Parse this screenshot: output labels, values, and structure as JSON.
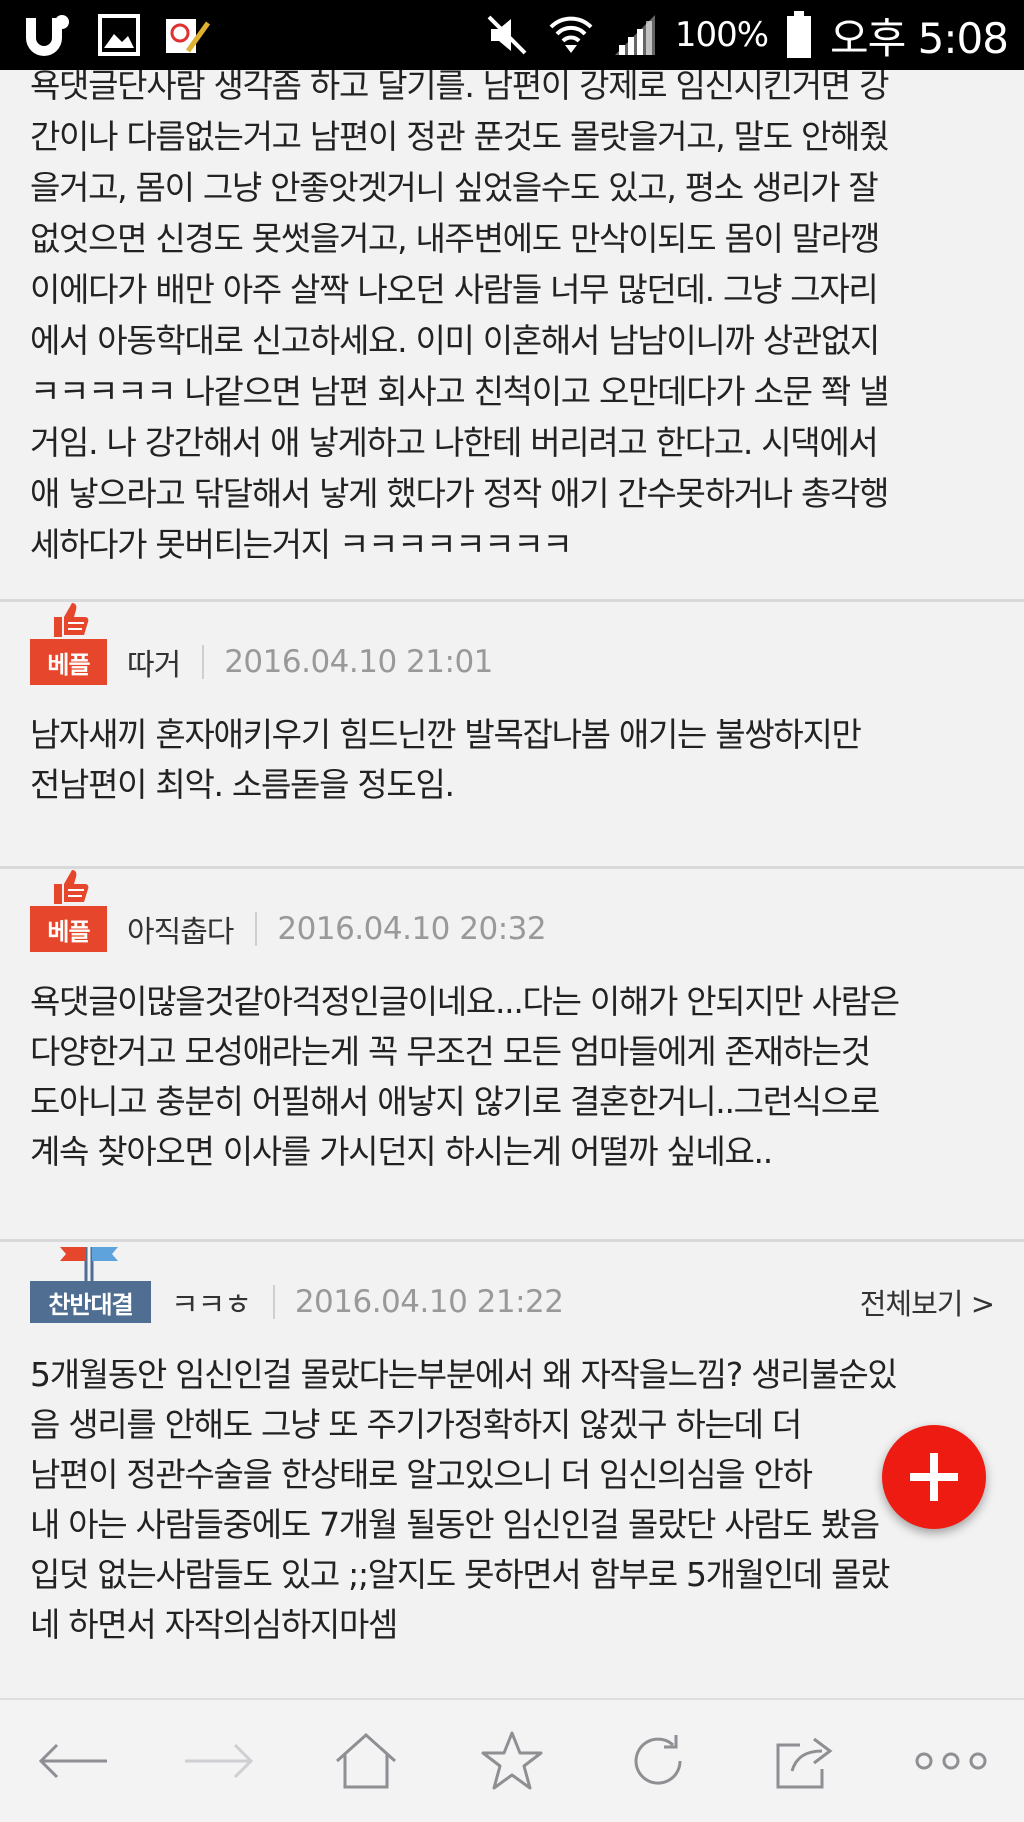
{
  "status_bar": {
    "battery": "100%",
    "time": "오후 5:08",
    "icons": [
      "u-app-icon",
      "gallery-icon",
      "memo-icon",
      "mute-icon",
      "wifi-icon",
      "signal-icon",
      "battery-icon"
    ]
  },
  "top_post": {
    "lines": [
      "욕댓글단사람 생각좀 하고 달기를. 남편이 강제로 임신시킨거면 강",
      "간이나 다름없는거고 남편이 정관 푼것도 몰랏을거고, 말도 안해줬",
      "을거고, 몸이 그냥 안좋앗겟거니 싶었을수도 있고, 평소 생리가 잘",
      "없엇으면 신경도 못썻을거고, 내주변에도 만삭이되도 몸이 말라깽",
      "이에다가 배만 아주 살짝 나오던 사람들 너무 많던데. 그냥 그자리",
      "에서 아동학대로 신고하세요. 이미 이혼해서 남남이니까 상관없지",
      "ㅋㅋㅋㅋㅋ 나같으면 남편 회사고 친척이고 오만데다가 소문 쫙 낼",
      "거임. 나 강간해서 애 낳게하고 나한테 버리려고 한다고. 시댁에서",
      "애 낳으라고 닦달해서 낳게 했다가 정작 애기 간수못하거나 총각행",
      "세하다가 못버티는거지 ㅋㅋㅋㅋㅋㅋㅋㅋ"
    ]
  },
  "comments": [
    {
      "badge": "베플",
      "nickname": "따거",
      "date": "2016.04.10 21:01",
      "lines": [
        "남자새끼 혼자애키우기 힘드닌깐 발목잡나봄 애기는 불쌍하지만",
        "전남편이 최악. 소름돋을 정도임."
      ]
    },
    {
      "badge": "베플",
      "nickname": "아직춥다",
      "date": "2016.04.10 20:32",
      "lines": [
        "욕댓글이많을것같아걱정인글이네요...다는 이해가 안되지만 사람은",
        "다양한거고 모성애라는게 꼭 무조건 모든 엄마들에게 존재하는것",
        "도아니고 충분히 어필해서 애낳지 않기로 결혼한거니..그런식으로",
        "계속 찾아오면 이사를 가시던지 하시는게 어떨까 싶네요.."
      ]
    },
    {
      "badge": "찬반대결",
      "nickname": "ㅋㅋㅎ",
      "date": "2016.04.10 21:22",
      "view_all": "전체보기 >",
      "lines": [
        "5개월동안 임신인걸 몰랐다는부분에서 왜 자작을느낌? 생리불순있",
        "음 생리를 안해도 그냥 또 주기가정확하지 않겠구 하는데 더",
        "남편이 정관수술을 한상태로 알고있으니 더 임신의심을 안하",
        "내 아는 사람들중에도 7개월 될동안 임신인걸 몰랐단 사람도 봤음",
        "입덧 없는사람들도 있고 ;;알지도 못하면서 함부로 5개월인데 몰랐",
        "네 하면서 자작의심하지마셈"
      ]
    }
  ],
  "fab": {
    "icon": "plus-icon",
    "color": "#ee1b12"
  },
  "bottom_nav": {
    "items": [
      "back-arrow-icon",
      "forward-arrow-icon",
      "home-icon",
      "star-icon",
      "refresh-icon",
      "share-icon",
      "more-icon"
    ]
  },
  "colors": {
    "best_badge": "#e6462c",
    "debate_badge": "#4f6e92",
    "date": "#999999"
  }
}
